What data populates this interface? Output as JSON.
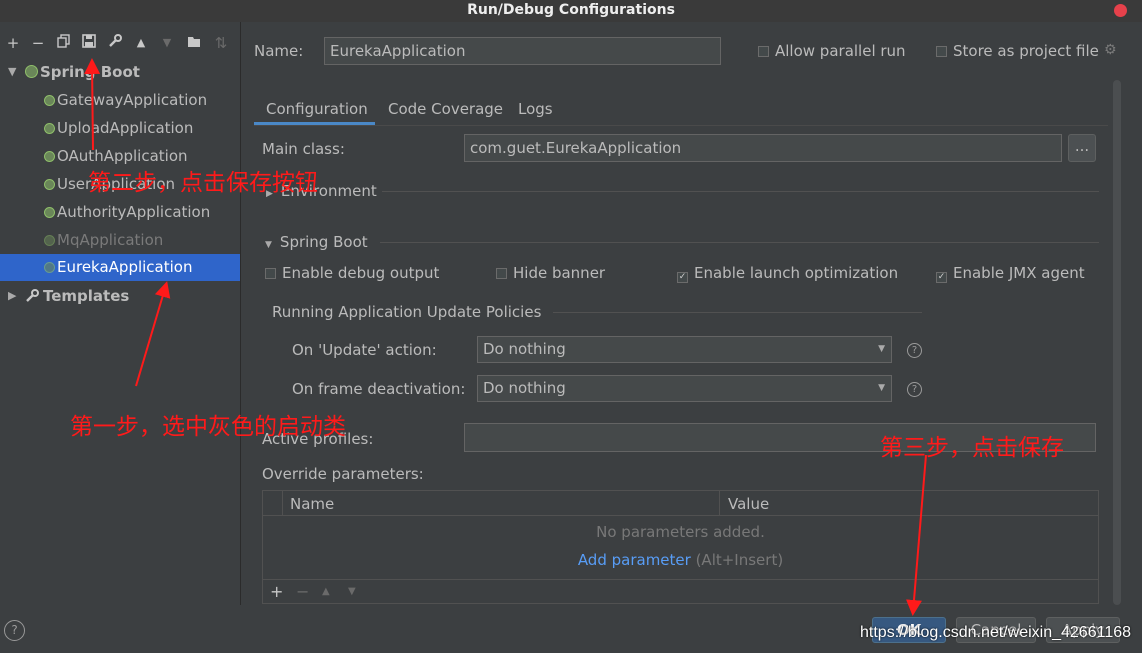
{
  "window": {
    "title": "Run/Debug Configurations"
  },
  "toolbar": {
    "add": "+",
    "remove": "−",
    "copy": "⧉",
    "save": "💾",
    "edit": "🔧",
    "up": "▲",
    "down": "▼",
    "folder": "📁",
    "sort": "⇅"
  },
  "tree": {
    "spring_boot": "Spring Boot",
    "items": [
      "GatewayApplication",
      "UploadApplication",
      "OAuthApplication",
      "UserApplication",
      "AuthorityApplication",
      "MqApplication",
      "EurekaApplication"
    ],
    "templates": "Templates"
  },
  "name_row": {
    "label": "Name:",
    "value": "EurekaApplication",
    "allow_parallel": "Allow parallel run",
    "store_as_project": "Store as project file"
  },
  "tabs": [
    "Configuration",
    "Code Coverage",
    "Logs"
  ],
  "main_class": {
    "label": "Main class:",
    "value": "com.guet.EurekaApplication",
    "browse": "..."
  },
  "environment": "Environment",
  "spring_boot_section": {
    "title": "Spring Boot",
    "enable_debug": "Enable debug output",
    "hide_banner": "Hide banner",
    "enable_launch": "Enable launch optimization",
    "enable_jmx": "Enable JMX agent"
  },
  "policies": {
    "title": "Running Application Update Policies",
    "update_label": "On 'Update' action:",
    "update_value": "Do nothing",
    "frame_label": "On frame deactivation:",
    "frame_value": "Do nothing"
  },
  "active_profiles": {
    "label": "Active profiles:",
    "value": ""
  },
  "override": {
    "label": "Override parameters:",
    "col_name": "Name",
    "col_value": "Value",
    "empty": "No parameters added.",
    "add_link": "Add parameter",
    "add_hint": " (Alt+Insert)"
  },
  "table_toolbar": {
    "add": "+",
    "remove": "−",
    "up": "▲",
    "down": "▼"
  },
  "buttons": {
    "ok": "OK",
    "cancel": "Cancel",
    "apply": "Apply",
    "help": "?"
  },
  "annotations": {
    "step1": "第一步，选中灰色的启动类",
    "step2": "第二步，点击保存按钮",
    "step3": "第三步，点击保存"
  },
  "watermark": "https://blog.csdn.net/weixin_42661168",
  "colors": {
    "selection": "#2f65ca",
    "annotation": "#ff1a1a",
    "link": "#589df6"
  }
}
